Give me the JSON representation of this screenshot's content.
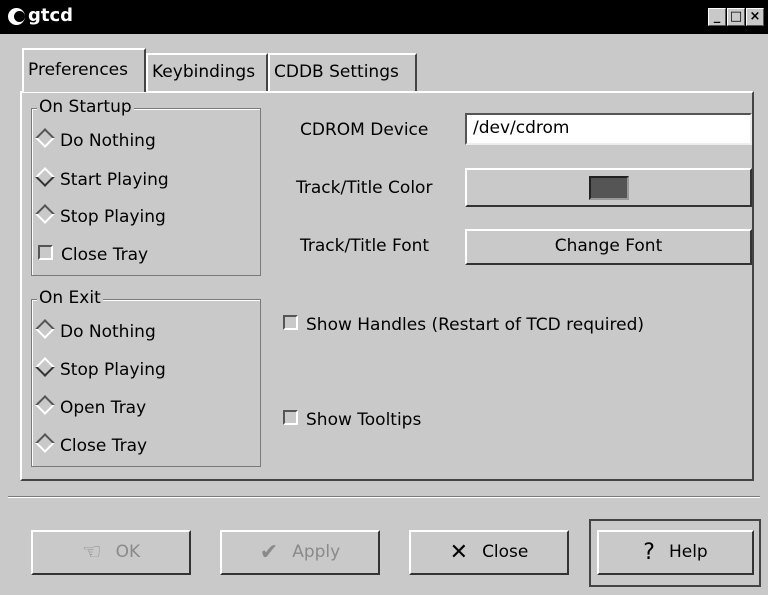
{
  "window": {
    "title": "gtcd",
    "min_glyph": "_",
    "max_glyph": "□",
    "close_glyph": "×"
  },
  "tabs": [
    "Preferences",
    "Keybindings",
    "CDDB Settings"
  ],
  "on_startup": {
    "label": "On Startup",
    "options": [
      {
        "label": "Do Nothing",
        "type": "radio",
        "selected": false
      },
      {
        "label": "Start Playing",
        "type": "radio",
        "selected": true
      },
      {
        "label": "Stop Playing",
        "type": "radio",
        "selected": false
      },
      {
        "label": "Close Tray",
        "type": "checkbox",
        "checked": false
      }
    ]
  },
  "on_exit": {
    "label": "On Exit",
    "options": [
      {
        "label": "Do Nothing",
        "type": "radio",
        "selected": false
      },
      {
        "label": "Stop Playing",
        "type": "radio",
        "selected": true
      },
      {
        "label": "Open Tray",
        "type": "radio",
        "selected": false
      },
      {
        "label": "Close Tray",
        "type": "radio",
        "selected": false
      }
    ]
  },
  "settings": {
    "cdrom_label": "CDROM Device",
    "cdrom_value": "/dev/cdrom",
    "color_label": "Track/Title Color",
    "color_value": "#555555",
    "font_label": "Track/Title Font",
    "font_button": "Change Font",
    "show_handles": "Show Handles (Restart of TCD required)",
    "show_tooltips": "Show Tooltips"
  },
  "buttons": {
    "ok": "OK",
    "apply": "Apply",
    "close": "Close",
    "help": "Help",
    "ok_icon": "hand-icon",
    "apply_icon": "checkmark-icon",
    "close_icon": "x-icon",
    "help_icon": "question-icon"
  }
}
